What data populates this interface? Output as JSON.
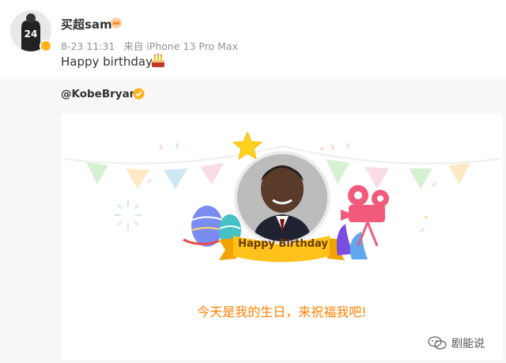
{
  "post": {
    "username": "买超sam",
    "date": "8-23 11:31",
    "source": "来自 iPhone 13 Pro Max",
    "text": "Happy birthday",
    "avatar_jersey_number": "24"
  },
  "repost": {
    "mention": "@KobeBryant",
    "card": {
      "banner_text": "Happy Birthday",
      "cta_text": "今天是我的生日，来祝福我吧!"
    }
  },
  "watermark": {
    "label": "剧能说"
  },
  "colors": {
    "accent_orange": "#ff8200",
    "verified_gold": "#ffb319",
    "ribbon_yellow": "#ffc21a",
    "background_grey": "#f7f7f7"
  },
  "icons": {
    "verified": "verified-badge-icon",
    "cake": "birthday-cake-icon",
    "star": "star-icon",
    "camera": "movie-camera-icon",
    "wechat": "wechat-icon"
  }
}
